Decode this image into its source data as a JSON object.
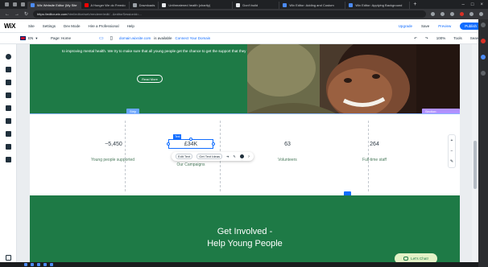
{
  "browser": {
    "tabs": [
      {
        "label": "Wix Website Editor (My Site",
        "color": "#4c8bf5"
      },
      {
        "label": "A Hunger We do Freedo",
        "color": "#ff0000"
      },
      {
        "label": "Downloads",
        "color": "#9aa0a6"
      },
      {
        "label": "Unthreatened health (charity)",
        "color": "#e8eaed"
      },
      {
        "label": "Don't build",
        "color": "#e8eaed"
      },
      {
        "label": "Wix Editor: Adding and Custom",
        "color": "#4c8bf5"
      },
      {
        "label": "Wix Editor: Applying Background",
        "color": "#4c8bf5"
      }
    ],
    "url_host": "https://editor.wix.com",
    "url_rest": "/html/editor/web/renderer/edit/...&editorSessionId=..."
  },
  "wix_top": {
    "logo": "WiX",
    "menu": [
      "Site",
      "Settings",
      "Dev Mode",
      "Hire a Professional",
      "Help"
    ],
    "upgrade": "Upgrade",
    "save": "Save",
    "preview": "Preview",
    "publish": "Publish"
  },
  "wix_bar2": {
    "lang": "EN",
    "page": "Page: Home",
    "domain_link": "domain.wixsite.com",
    "domain_status": "is available",
    "connect": "Connect Your Domain",
    "zoom": "100%",
    "tools": "Tools",
    "search": "Search"
  },
  "site": {
    "hero_text": "to improving mental health. We try to make sure that all young people get the chance to get the support that they need",
    "read_more": "Read More",
    "strip_tag": "Strip",
    "strip_tag_right": "Section: Achievements",
    "stats": [
      {
        "num": "~5,450",
        "label": "Young people supported"
      },
      {
        "num": "£34K",
        "label": "Our Campaigns"
      },
      {
        "num": "63",
        "label": "Volunteers"
      },
      {
        "num": "264",
        "label": "Full-time staff"
      }
    ],
    "selected_tag": "Text",
    "toolbar": {
      "edit_text": "Edit Text",
      "get_text_ideas": "Get Text Ideas"
    },
    "involve_line1": "Get Involved -",
    "involve_line2": "Help Young People",
    "chat": "Let's Chat!"
  },
  "colors": {
    "brand_green": "#1e7a46",
    "wix_blue": "#116dff"
  }
}
